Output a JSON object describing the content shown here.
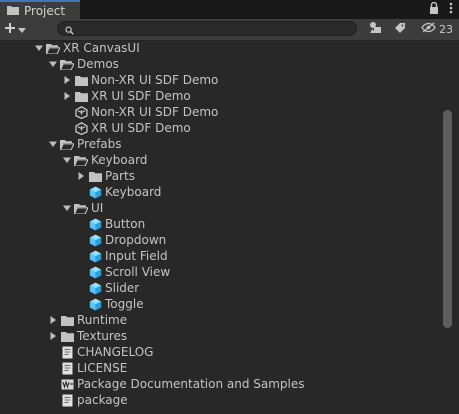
{
  "tab": {
    "label": "Project"
  },
  "toolbar": {
    "create_label": "+",
    "search_value": "",
    "hidden_count": "23"
  },
  "tree": [
    {
      "label": "XR CanvasUI",
      "depth": 0,
      "icon": "folder-open-icon",
      "arrow": "down"
    },
    {
      "label": "Demos",
      "depth": 1,
      "icon": "folder-open-icon",
      "arrow": "down"
    },
    {
      "label": "Non-XR UI SDF Demo",
      "depth": 2,
      "icon": "folder-icon",
      "arrow": "right"
    },
    {
      "label": "XR UI SDF Demo",
      "depth": 2,
      "icon": "folder-icon",
      "arrow": "right"
    },
    {
      "label": "Non-XR UI SDF Demo",
      "depth": 2,
      "icon": "unity-scene-icon",
      "arrow": "none"
    },
    {
      "label": "XR UI SDF Demo",
      "depth": 2,
      "icon": "unity-scene-icon",
      "arrow": "none"
    },
    {
      "label": "Prefabs",
      "depth": 1,
      "icon": "folder-open-icon",
      "arrow": "down"
    },
    {
      "label": "Keyboard",
      "depth": 2,
      "icon": "folder-open-icon",
      "arrow": "down"
    },
    {
      "label": "Parts",
      "depth": 3,
      "icon": "folder-icon",
      "arrow": "right"
    },
    {
      "label": "Keyboard",
      "depth": 3,
      "icon": "prefab-icon",
      "arrow": "none"
    },
    {
      "label": "UI",
      "depth": 2,
      "icon": "folder-open-icon",
      "arrow": "down"
    },
    {
      "label": "Button",
      "depth": 3,
      "icon": "prefab-icon",
      "arrow": "none"
    },
    {
      "label": "Dropdown",
      "depth": 3,
      "icon": "prefab-icon",
      "arrow": "none"
    },
    {
      "label": "Input Field",
      "depth": 3,
      "icon": "prefab-icon",
      "arrow": "none"
    },
    {
      "label": "Scroll View",
      "depth": 3,
      "icon": "prefab-icon",
      "arrow": "none"
    },
    {
      "label": "Slider",
      "depth": 3,
      "icon": "prefab-icon",
      "arrow": "none"
    },
    {
      "label": "Toggle",
      "depth": 3,
      "icon": "prefab-icon",
      "arrow": "none"
    },
    {
      "label": "Runtime",
      "depth": 1,
      "icon": "folder-icon",
      "arrow": "right"
    },
    {
      "label": "Textures",
      "depth": 1,
      "icon": "folder-icon",
      "arrow": "right"
    },
    {
      "label": "CHANGELOG",
      "depth": 1,
      "icon": "text-file-icon",
      "arrow": "none"
    },
    {
      "label": "LICENSE",
      "depth": 1,
      "icon": "text-file-icon",
      "arrow": "none"
    },
    {
      "label": "Package Documentation and Samples",
      "depth": 1,
      "icon": "doc-link-icon",
      "arrow": "none"
    },
    {
      "label": "package",
      "depth": 1,
      "icon": "text-file-icon",
      "arrow": "none"
    }
  ],
  "colors": {
    "accent": "#3a79bb",
    "prefab": "#5cc3f3",
    "folder": "#c2c2c2"
  }
}
